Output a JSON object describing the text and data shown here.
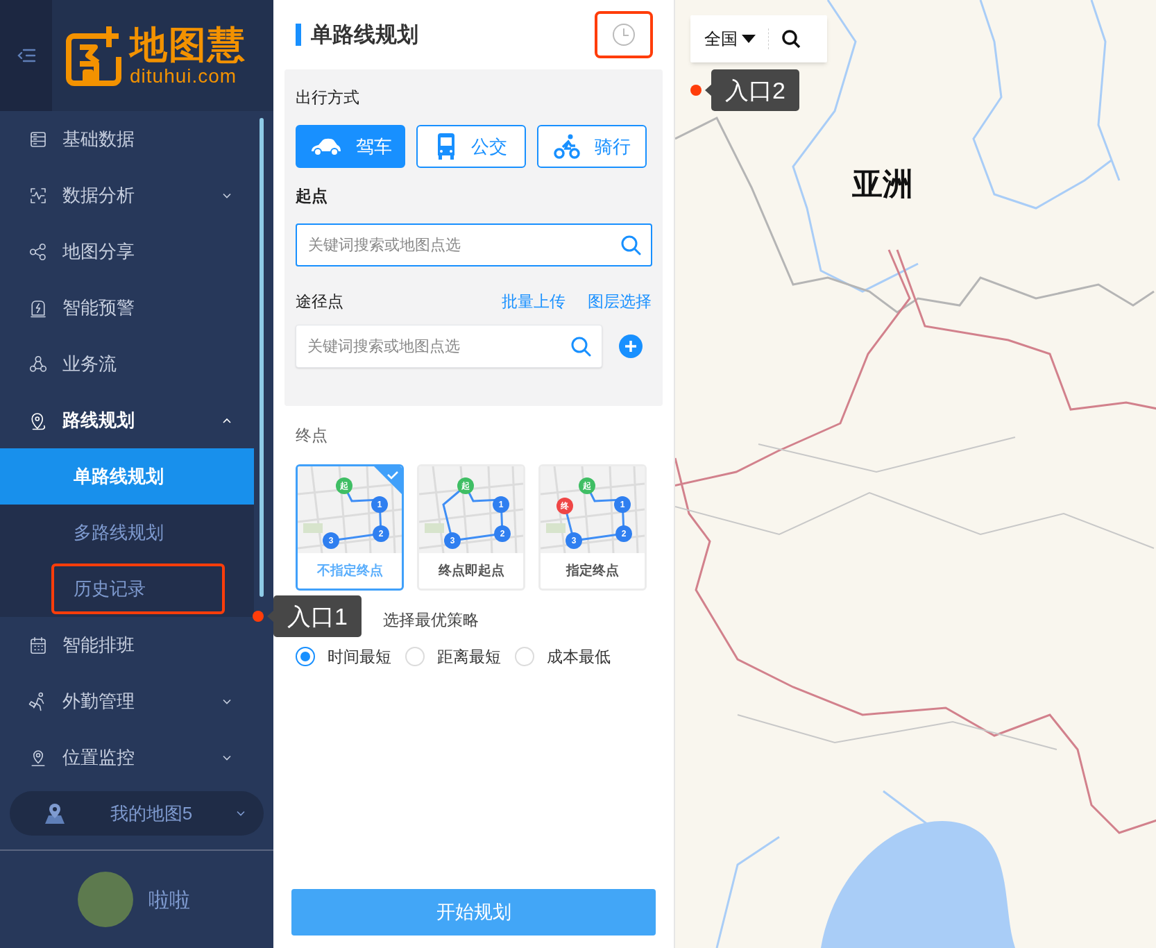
{
  "sidebar": {
    "logo": {
      "name": "地图慧",
      "domain": "dituhui.com"
    },
    "menu": [
      {
        "label": "基础数据",
        "selected": false
      },
      {
        "label": "数据分析",
        "selected": false,
        "expanded": false
      },
      {
        "label": "地图分享",
        "selected": false
      },
      {
        "label": "智能预警",
        "selected": false
      },
      {
        "label": "业务流",
        "selected": false
      },
      {
        "label": "路线规划",
        "selected": true,
        "expanded": true,
        "children": [
          {
            "label": "单路线规划",
            "selected": true,
            "annotated": false
          },
          {
            "label": "多路线规划",
            "selected": false,
            "annotated": false
          },
          {
            "label": "历史记录",
            "selected": false,
            "annotated": true
          }
        ]
      },
      {
        "label": "智能排班",
        "selected": false
      },
      {
        "label": "外勤管理",
        "selected": false,
        "expanded": false
      },
      {
        "label": "位置监控",
        "selected": false,
        "expanded": false
      }
    ],
    "map_switcher": {
      "label": "我的地图5"
    },
    "user": {
      "name": "啦啦"
    }
  },
  "panel": {
    "title": "单路线规划",
    "history_button": {
      "annotated": true
    },
    "travel": {
      "label": "出行方式",
      "modes": [
        {
          "label": "驾车",
          "selected": true
        },
        {
          "label": "公交",
          "selected": false
        },
        {
          "label": "骑行",
          "selected": false
        }
      ]
    },
    "start": {
      "label": "起点",
      "placeholder": "关键词搜索或地图点选",
      "focused": true
    },
    "waypoints": {
      "label": "途径点",
      "links": [
        "批量上传",
        "图层选择"
      ],
      "placeholder": "关键词搜索或地图点选",
      "focused": false
    },
    "end": {
      "label": "终点",
      "options": [
        {
          "label": "不指定终点",
          "selected": true,
          "markers": [
            {
              "text": "起",
              "kind": "start"
            },
            {
              "text": "1",
              "kind": "stop"
            },
            {
              "text": "2",
              "kind": "stop"
            },
            {
              "text": "3",
              "kind": "stop"
            }
          ]
        },
        {
          "label": "终点即起点",
          "selected": false,
          "markers": [
            {
              "text": "起",
              "kind": "start"
            },
            {
              "text": "1",
              "kind": "stop"
            },
            {
              "text": "2",
              "kind": "stop"
            },
            {
              "text": "3",
              "kind": "stop"
            }
          ]
        },
        {
          "label": "指定终点",
          "selected": false,
          "markers": [
            {
              "text": "起",
              "kind": "start"
            },
            {
              "text": "1",
              "kind": "stop"
            },
            {
              "text": "2",
              "kind": "stop"
            },
            {
              "text": "3",
              "kind": "stop"
            },
            {
              "text": "终",
              "kind": "end"
            }
          ]
        }
      ]
    },
    "strategy": {
      "label": "选择最优策略",
      "options": [
        {
          "label": "时间最短",
          "selected": true
        },
        {
          "label": "距离最短",
          "selected": false
        },
        {
          "label": "成本最低",
          "selected": false
        }
      ]
    },
    "submit": "开始规划"
  },
  "map": {
    "region": "全国",
    "label": "亚洲"
  },
  "annotations": [
    {
      "label": "入口1"
    },
    {
      "label": "入口2"
    }
  ]
}
